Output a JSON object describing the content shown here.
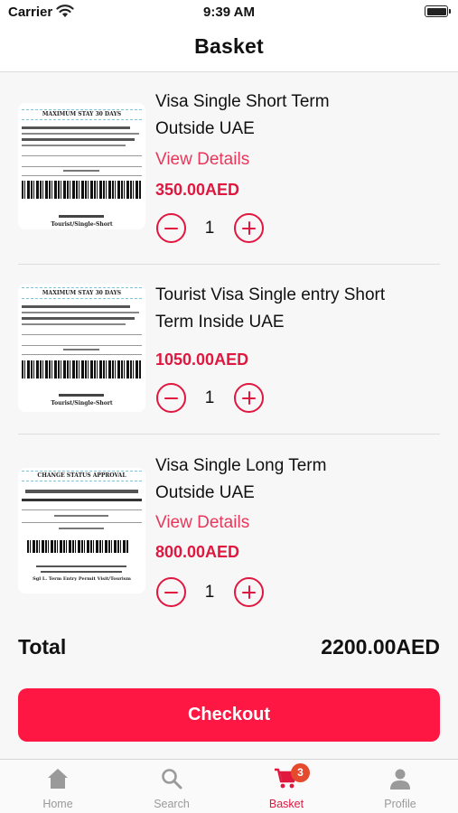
{
  "status_bar": {
    "carrier": "Carrier",
    "time": "9:39 AM"
  },
  "nav": {
    "title": "Basket"
  },
  "items": [
    {
      "name_line1": "Visa Single Short Term",
      "name_line2": "Outside UAE",
      "details_label": "View Details",
      "price": "350.00AED",
      "quantity": "1",
      "thumb_header": "MAXIMUM STAY 30 DAYS",
      "thumb_footer": "Tourist/Single-Short"
    },
    {
      "name_line1": "Tourist Visa Single entry Short",
      "name_line2": "Term Inside UAE",
      "price": "1050.00AED",
      "quantity": "1",
      "thumb_header": "MAXIMUM STAY 30 DAYS",
      "thumb_footer": "Tourist/Single-Short"
    },
    {
      "name_line1": "Visa Single Long Term",
      "name_line2": "Outside UAE",
      "details_label": "View Details",
      "price": "800.00AED",
      "quantity": "1",
      "thumb_header": "CHANGE STATUS APPROVAL",
      "thumb_footer": "Sgl L. Term Entry Permit Visit/Tourism"
    }
  ],
  "total": {
    "label": "Total",
    "value": "2200.00AED"
  },
  "checkout_label": "Checkout",
  "tabs": [
    {
      "label": "Home",
      "icon": "home-icon"
    },
    {
      "label": "Search",
      "icon": "search-icon"
    },
    {
      "label": "Basket",
      "icon": "cart-icon",
      "badge": "3",
      "active": true
    },
    {
      "label": "Profile",
      "icon": "person-icon"
    }
  ],
  "colors": {
    "accent": "#e0173f",
    "checkout_bg": "#ff1744",
    "badge_bg": "#e64a2e",
    "link": "#e8375a"
  }
}
